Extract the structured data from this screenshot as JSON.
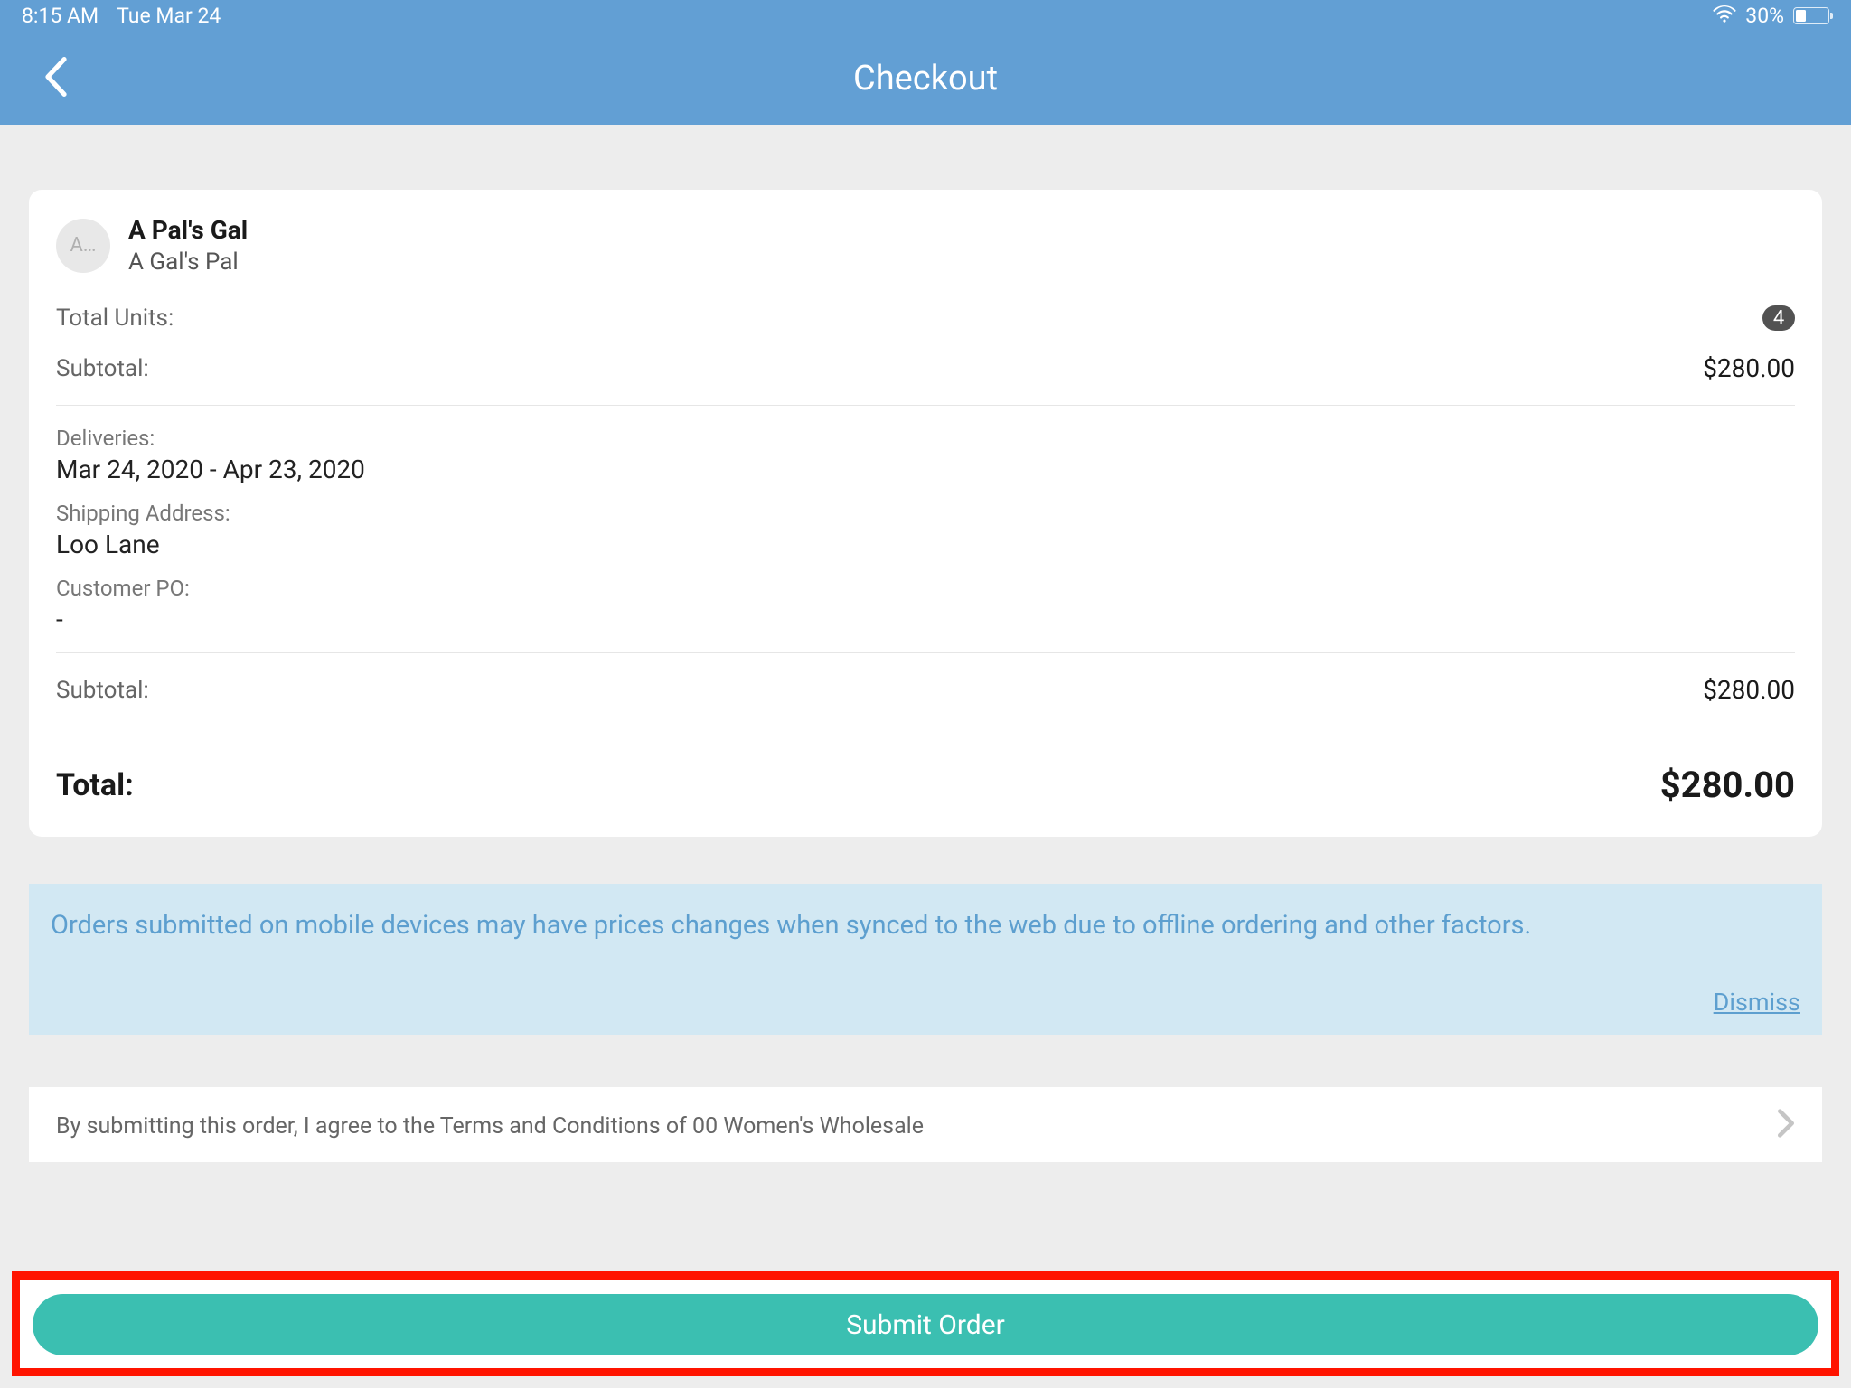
{
  "status": {
    "time": "8:15 AM",
    "date": "Tue Mar 24",
    "battery_pct": "30%"
  },
  "nav": {
    "title": "Checkout"
  },
  "customer": {
    "avatar_letter": "A…",
    "name": "A Pal's Gal",
    "subtitle": "A Gal's Pal"
  },
  "summary": {
    "total_units_label": "Total Units:",
    "total_units_value": "4",
    "subtotal_label_1": "Subtotal:",
    "subtotal_value_1": "$280.00",
    "deliveries_label": "Deliveries:",
    "deliveries_value": "Mar 24, 2020 - Apr 23, 2020",
    "shipping_label": "Shipping Address:",
    "shipping_value": "Loo Lane",
    "po_label": "Customer PO:",
    "po_value": "-",
    "subtotal_label_2": "Subtotal:",
    "subtotal_value_2": "$280.00",
    "total_label": "Total:",
    "total_value": "$280.00"
  },
  "banner": {
    "text": "Orders submitted on mobile devices may have prices changes when synced to the web due to offline ordering and other factors.",
    "dismiss": "Dismiss"
  },
  "terms": {
    "text": "By submitting this order, I agree to the Terms and Conditions of 00 Women's Wholesale"
  },
  "submit": {
    "label": "Submit Order"
  }
}
